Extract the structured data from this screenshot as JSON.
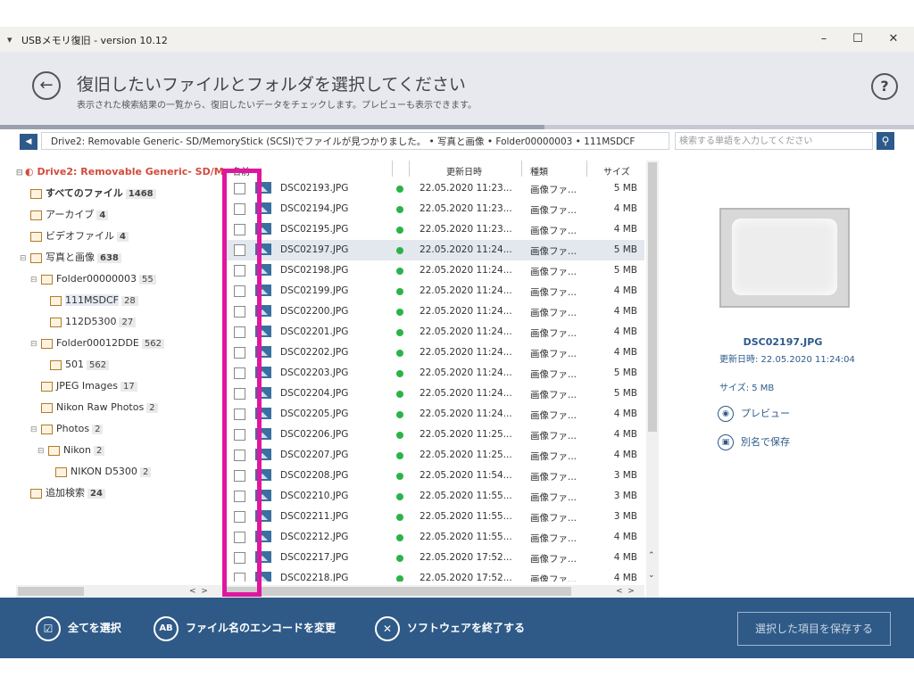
{
  "window": {
    "title": "USBメモリ復旧 - version 10.12",
    "minimize": "–",
    "maximize": "☐",
    "close": "✕"
  },
  "header": {
    "title": "復旧したいファイルとフォルダを選択してください",
    "subtitle": "表示された検索結果の一覧から、復旧したいデータをチェックします。プレビューも表示できます。",
    "help": "?"
  },
  "pathbar": {
    "path": "Drive2: Removable Generic- SD/MemoryStick (SCSI)でファイルが見つかりました。 • 写真と画像 • Folder00000003 • 111MSDCF",
    "search_placeholder": "検索する単語を入力してください"
  },
  "tree": [
    {
      "label": "Drive2: Removable Generic- SD/M",
      "count": "",
      "root": true
    },
    {
      "label": "すべてのファイル",
      "count": "1468"
    },
    {
      "label": "アーカイブ",
      "count": "4"
    },
    {
      "label": "ビデオファイル",
      "count": "4"
    },
    {
      "label": "写真と画像",
      "count": "638"
    },
    {
      "label": "Folder00000003",
      "count": "55"
    },
    {
      "label": "111MSDCF",
      "count": "28"
    },
    {
      "label": "112D5300",
      "count": "27"
    },
    {
      "label": "Folder00012DDE",
      "count": "562"
    },
    {
      "label": "501",
      "count": "562"
    },
    {
      "label": "JPEG Images",
      "count": "17"
    },
    {
      "label": "Nikon Raw Photos",
      "count": "2"
    },
    {
      "label": "Photos",
      "count": "2"
    },
    {
      "label": "Nikon",
      "count": "2"
    },
    {
      "label": "NIKON D5300",
      "count": "2"
    },
    {
      "label": "追加検索",
      "count": "24"
    }
  ],
  "columns": {
    "name": "名前",
    "date": "更新日時",
    "kind": "種類",
    "size": "サイズ"
  },
  "files": [
    {
      "name": "DSC02193.JPG",
      "date": "22.05.2020 11:23...",
      "kind": "画像ファ...",
      "size": "5 MB"
    },
    {
      "name": "DSC02194.JPG",
      "date": "22.05.2020 11:23...",
      "kind": "画像ファ...",
      "size": "4 MB"
    },
    {
      "name": "DSC02195.JPG",
      "date": "22.05.2020 11:23...",
      "kind": "画像ファ...",
      "size": "4 MB"
    },
    {
      "name": "DSC02197.JPG",
      "date": "22.05.2020 11:24...",
      "kind": "画像ファ...",
      "size": "5 MB"
    },
    {
      "name": "DSC02198.JPG",
      "date": "22.05.2020 11:24...",
      "kind": "画像ファ...",
      "size": "5 MB"
    },
    {
      "name": "DSC02199.JPG",
      "date": "22.05.2020 11:24...",
      "kind": "画像ファ...",
      "size": "4 MB"
    },
    {
      "name": "DSC02200.JPG",
      "date": "22.05.2020 11:24...",
      "kind": "画像ファ...",
      "size": "4 MB"
    },
    {
      "name": "DSC02201.JPG",
      "date": "22.05.2020 11:24...",
      "kind": "画像ファ...",
      "size": "4 MB"
    },
    {
      "name": "DSC02202.JPG",
      "date": "22.05.2020 11:24...",
      "kind": "画像ファ...",
      "size": "4 MB"
    },
    {
      "name": "DSC02203.JPG",
      "date": "22.05.2020 11:24...",
      "kind": "画像ファ...",
      "size": "5 MB"
    },
    {
      "name": "DSC02204.JPG",
      "date": "22.05.2020 11:24...",
      "kind": "画像ファ...",
      "size": "5 MB"
    },
    {
      "name": "DSC02205.JPG",
      "date": "22.05.2020 11:24...",
      "kind": "画像ファ...",
      "size": "4 MB"
    },
    {
      "name": "DSC02206.JPG",
      "date": "22.05.2020 11:25...",
      "kind": "画像ファ...",
      "size": "4 MB"
    },
    {
      "name": "DSC02207.JPG",
      "date": "22.05.2020 11:25...",
      "kind": "画像ファ...",
      "size": "4 MB"
    },
    {
      "name": "DSC02208.JPG",
      "date": "22.05.2020 11:54...",
      "kind": "画像ファ...",
      "size": "3 MB"
    },
    {
      "name": "DSC02210.JPG",
      "date": "22.05.2020 11:55...",
      "kind": "画像ファ...",
      "size": "3 MB"
    },
    {
      "name": "DSC02211.JPG",
      "date": "22.05.2020 11:55...",
      "kind": "画像ファ...",
      "size": "3 MB"
    },
    {
      "name": "DSC02212.JPG",
      "date": "22.05.2020 11:55...",
      "kind": "画像ファ...",
      "size": "4 MB"
    },
    {
      "name": "DSC02217.JPG",
      "date": "22.05.2020 17:52...",
      "kind": "画像ファ...",
      "size": "4 MB"
    },
    {
      "name": "DSC02218.JPG",
      "date": "22.05.2020 17:52...",
      "kind": "画像ファ...",
      "size": "4 MB"
    }
  ],
  "preview": {
    "filename": "DSC02197.JPG",
    "modified": "更新日時: 22.05.2020 11:24:04",
    "size": "サイズ: 5 MB",
    "preview_label": "プレビュー",
    "save_as_label": "別名で保存"
  },
  "footer": {
    "select_all": "全てを選択",
    "change_encoding": "ファイル名のエンコードを変更",
    "quit": "ソフトウェアを終了する",
    "save_selected": "選択した項目を保存する"
  },
  "colors": {
    "accent": "#2f5a87",
    "highlight": "#e0179e",
    "root_red": "#d24b3c",
    "status_green": "#2bb34a"
  }
}
